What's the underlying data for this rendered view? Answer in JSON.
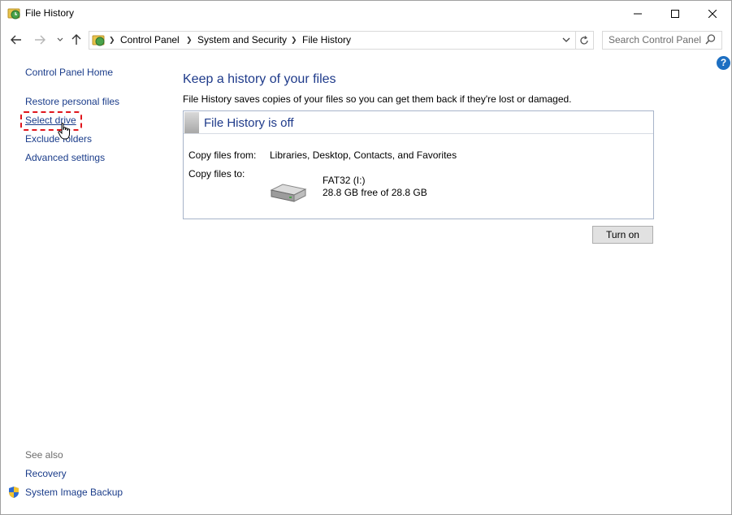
{
  "window": {
    "title": "File History"
  },
  "address": {
    "crumbs": [
      "Control Panel",
      "System and Security",
      "File History"
    ]
  },
  "search": {
    "placeholder": "Search Control Panel"
  },
  "help": {
    "label": "?"
  },
  "left_pane": {
    "home": "Control Panel Home",
    "links": {
      "restore": "Restore personal files",
      "select_drive": "Select drive",
      "exclude": "Exclude folders",
      "advanced": "Advanced settings"
    },
    "see_also": {
      "heading": "See also",
      "recovery": "Recovery",
      "system_image_backup": "System Image Backup"
    }
  },
  "main": {
    "title": "Keep a history of your files",
    "description": "File History saves copies of your files so you can get them back if they're lost or damaged.",
    "panel": {
      "status": "File History is off",
      "copy_from_label": "Copy files from:",
      "copy_from_value": "Libraries, Desktop, Contacts, and Favorites",
      "copy_to_label": "Copy files to:",
      "drive_name": "FAT32 (I:)",
      "drive_space": "28.8 GB free of 28.8 GB"
    },
    "turn_on_button": "Turn on"
  },
  "colors": {
    "link": "#1a3c8a",
    "heading": "#1e3a8a",
    "highlight": "#e0161c",
    "help": "#1d6fc2"
  }
}
